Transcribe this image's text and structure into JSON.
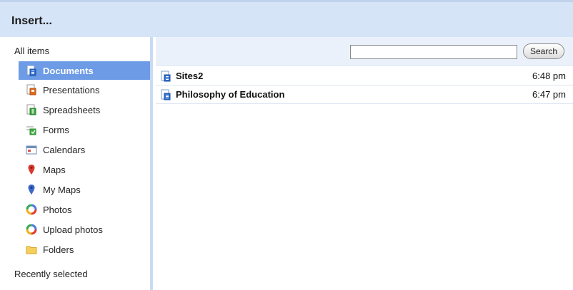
{
  "dialog": {
    "title": "Insert..."
  },
  "sidebar": {
    "heading": "All items",
    "items": [
      {
        "label": "Documents",
        "icon": "document-icon",
        "selected": true
      },
      {
        "label": "Presentations",
        "icon": "presentation-icon"
      },
      {
        "label": "Spreadsheets",
        "icon": "spreadsheet-icon"
      },
      {
        "label": "Forms",
        "icon": "form-icon"
      },
      {
        "label": "Calendars",
        "icon": "calendar-icon"
      },
      {
        "label": "Maps",
        "icon": "map-pin-icon"
      },
      {
        "label": "My Maps",
        "icon": "my-map-pin-icon"
      },
      {
        "label": "Photos",
        "icon": "photos-icon"
      },
      {
        "label": "Upload photos",
        "icon": "upload-photos-icon"
      },
      {
        "label": "Folders",
        "icon": "folder-icon"
      }
    ],
    "footer": "Recently selected"
  },
  "search": {
    "value": "",
    "placeholder": "",
    "button_label": "Search"
  },
  "files": [
    {
      "name": "Sites2",
      "time": "6:48 pm",
      "icon": "document-icon"
    },
    {
      "name": "Philosophy of Education",
      "time": "6:47 pm",
      "icon": "document-icon"
    }
  ],
  "colors": {
    "titlebar_bg": "#d6e4f7",
    "selected_item_bg": "#6d9be6",
    "toolbar_bg": "#eaf1fb"
  }
}
